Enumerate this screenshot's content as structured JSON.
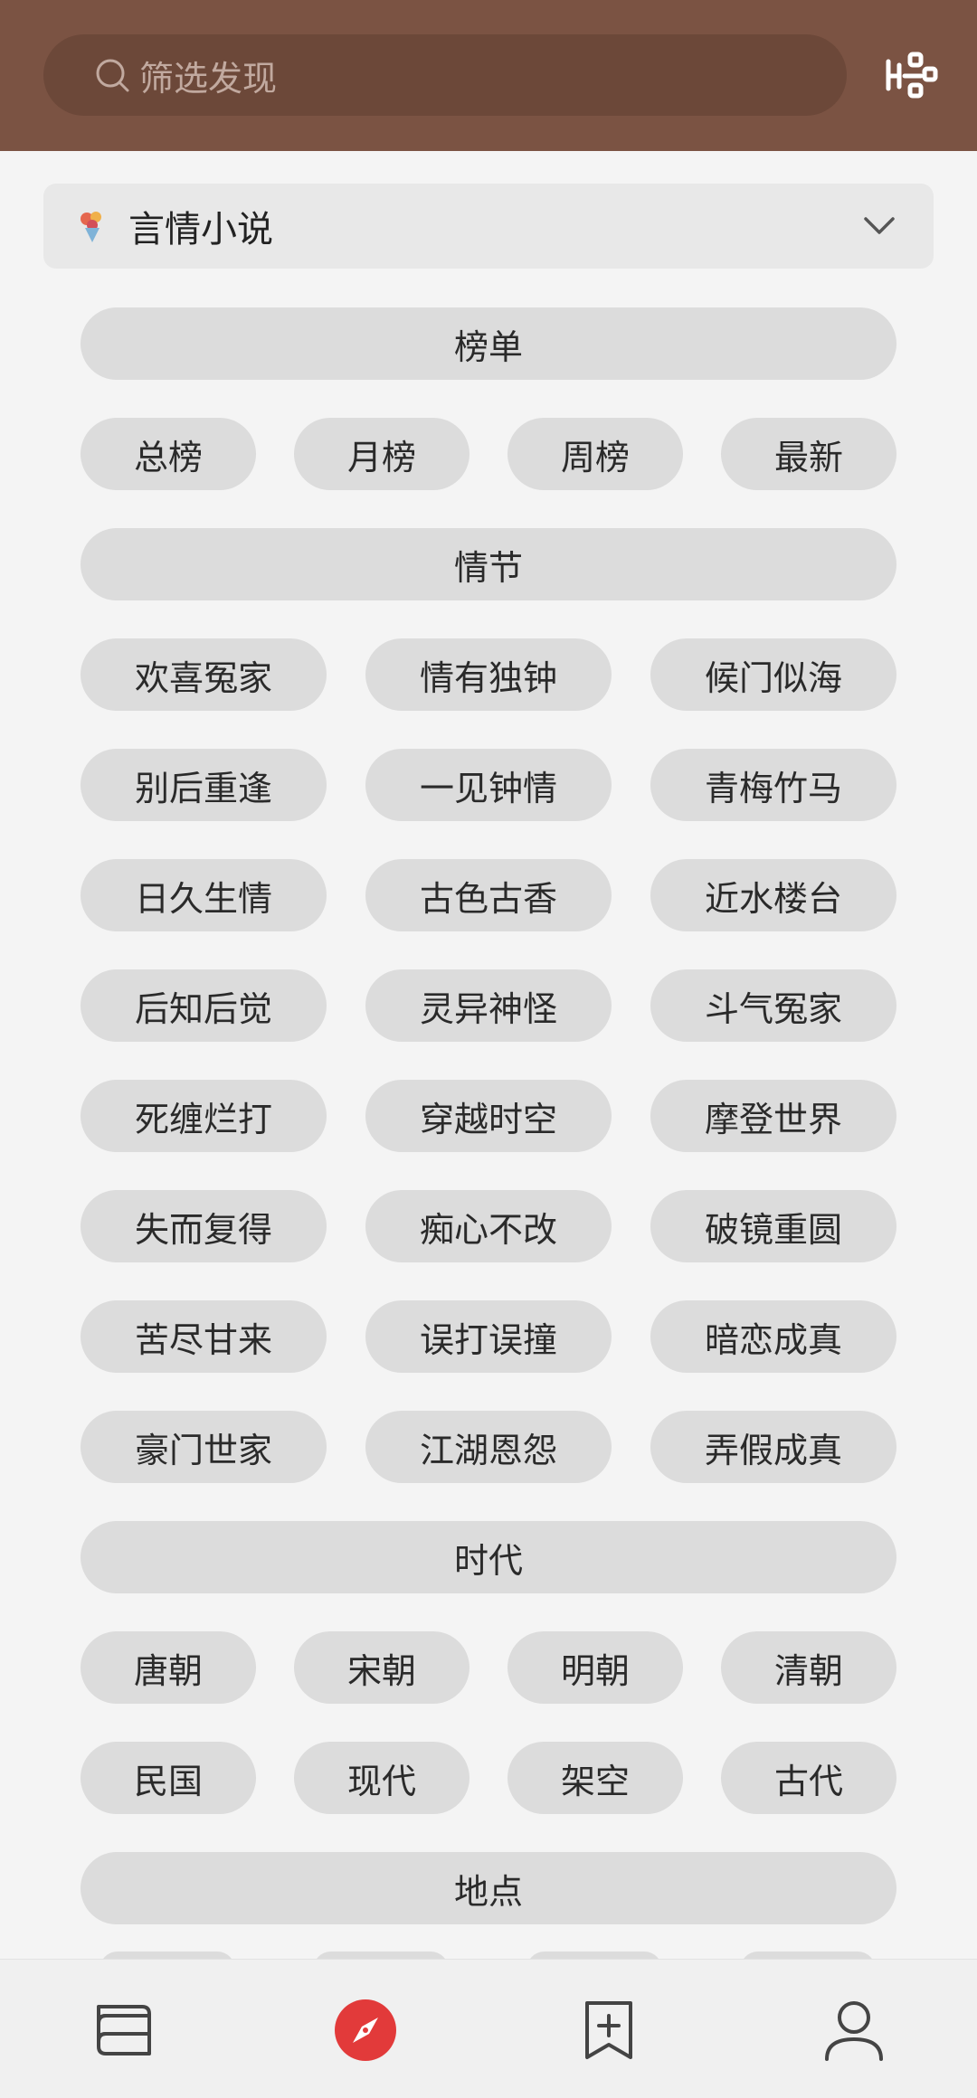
{
  "search": {
    "placeholder": "筛选发现"
  },
  "category": {
    "label": "言情小说"
  },
  "sections": [
    {
      "title": "榜单",
      "tags": [
        "总榜",
        "月榜",
        "周榜",
        "最新"
      ]
    },
    {
      "title": "情节",
      "tags": [
        "欢喜冤家",
        "情有独钟",
        "候门似海",
        "别后重逢",
        "一见钟情",
        "青梅竹马",
        "日久生情",
        "古色古香",
        "近水楼台",
        "后知后觉",
        "灵异神怪",
        "斗气冤家",
        "死缠烂打",
        "穿越时空",
        "摩登世界",
        "失而复得",
        "痴心不改",
        "破镜重圆",
        "苦尽甘来",
        "误打误撞",
        "暗恋成真",
        "豪门世家",
        "江湖恩怨",
        "弄假成真"
      ]
    },
    {
      "title": "时代",
      "tags": [
        "唐朝",
        "宋朝",
        "明朝",
        "清朝",
        "民国",
        "现代",
        "架空",
        "古代"
      ]
    },
    {
      "title": "地点",
      "tags": []
    }
  ],
  "bottom_nav": [
    {
      "name": "bookshelf-icon",
      "active": false
    },
    {
      "name": "compass-icon",
      "active": true
    },
    {
      "name": "bookmark-add-icon",
      "active": false
    },
    {
      "name": "user-icon",
      "active": false
    }
  ],
  "colors": {
    "header": "#7b5343",
    "search_bg": "#6c4839",
    "accent": "#e23a3a",
    "pill": "#dcdcdc"
  }
}
